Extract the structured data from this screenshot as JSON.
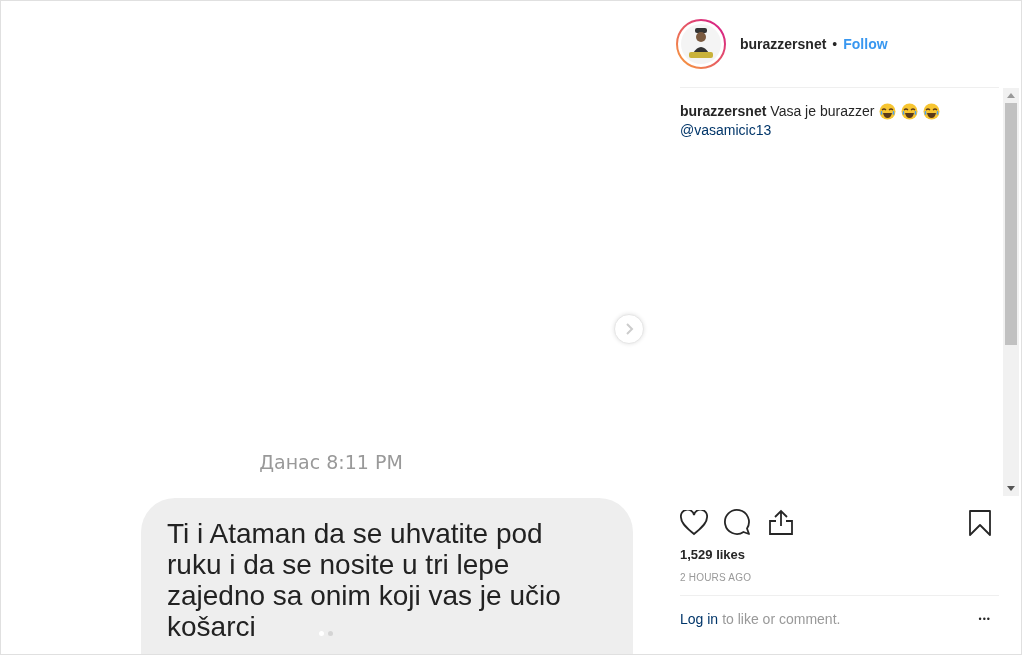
{
  "media": {
    "timestamp": "Данас 8:11 PM",
    "message": "Ti i Ataman da se uhvatite pod ruku i da se nosite u tri lepe zajedno sa onim koji vas je učio košarci",
    "carousel_dots": [
      {
        "selected": true
      },
      {
        "selected": false
      }
    ]
  },
  "header": {
    "username": "burazzersnet",
    "separator": "•",
    "follow": "Follow"
  },
  "caption": {
    "username": "burazzersnet",
    "text": "Vasa je burazzer",
    "emojis": [
      {
        "kind": "laughing"
      },
      {
        "kind": "laughing"
      },
      {
        "kind": "laughing"
      }
    ],
    "mention": "@vasamicic13"
  },
  "likes": "1,529 likes",
  "time": "2 HOURS AGO",
  "footer": {
    "login": "Log in",
    "prompt": "to like or comment.",
    "more": "•••"
  }
}
